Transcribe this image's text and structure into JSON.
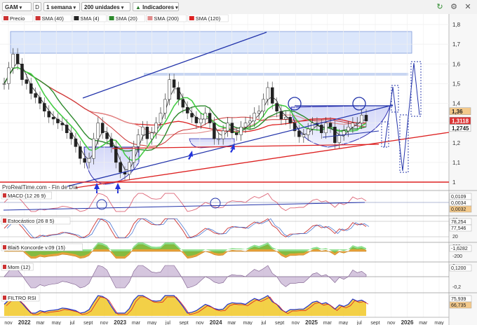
{
  "toolbar": {
    "symbol": "GAM",
    "d_button": "D",
    "period": "1 semana",
    "units": "200 unidades",
    "indicators": "Indicadores",
    "close_icon": "x-icon",
    "settings_icon": "gear-icon",
    "refresh_icon": "refresh-icon"
  },
  "main_legend": [
    {
      "label": "Precio",
      "color": "#cc3333"
    },
    {
      "label": "SMA (40)",
      "color": "#cc3333"
    },
    {
      "label": "SMA (4)",
      "color": "#222222"
    },
    {
      "label": "SMA (20)",
      "color": "#2d8a2d"
    },
    {
      "label": "SMA (200)",
      "color": "#e08a8a"
    },
    {
      "label": "SMA (120)",
      "color": "#dd2222"
    }
  ],
  "watermark": "ProRealTime.com - Fin de Día",
  "chart_data": {
    "type": "candlestick",
    "instrument": "GAM",
    "x_ticks": [
      "nov",
      "2022",
      "mar",
      "may",
      "jul",
      "sept",
      "nov",
      "2023",
      "mar",
      "may",
      "jul",
      "sept",
      "nov",
      "2024",
      "mar",
      "may",
      "jul",
      "sept",
      "nov",
      "2025",
      "mar",
      "may",
      "jul",
      "sept",
      "nov",
      "2026",
      "mar",
      "may"
    ],
    "y_ticks": [
      "1,8",
      "1,7",
      "1,6",
      "1,5",
      "1,4",
      "1,3",
      "1,2",
      "1,1",
      "1"
    ],
    "ylim": [
      1,
      1.8
    ],
    "price_tags": [
      {
        "text": "1,36",
        "value": 1.36,
        "bg": "#f3c98b"
      },
      {
        "text": "1,3118",
        "value": 1.3118,
        "bg": "#dd3333"
      },
      {
        "text": "1,2745",
        "value": 1.2745,
        "bg": "#ffffff"
      }
    ],
    "weekly_close": [
      1.5,
      1.58,
      1.65,
      1.6,
      1.52,
      1.5,
      1.45,
      1.43,
      1.4,
      1.36,
      1.33,
      1.32,
      1.3,
      1.29,
      1.25,
      1.22,
      1.18,
      1.12,
      1.1,
      1.12,
      1.22,
      1.3,
      1.25,
      1.22,
      1.18,
      1.1,
      1.05,
      1.04,
      1.1,
      1.18,
      1.24,
      1.28,
      1.22,
      1.25,
      1.3,
      1.35,
      1.42,
      1.52,
      1.48,
      1.42,
      1.38,
      1.35,
      1.33,
      1.3,
      1.32,
      1.35,
      1.3,
      1.22,
      1.22,
      1.26,
      1.3,
      1.25,
      1.24,
      1.28,
      1.3,
      1.31,
      1.35,
      1.36,
      1.42,
      1.48,
      1.4,
      1.36,
      1.32,
      1.33,
      1.3,
      1.26,
      1.23,
      1.24,
      1.27,
      1.3,
      1.29,
      1.25,
      1.3,
      1.28,
      1.2,
      1.24,
      1.26,
      1.28,
      1.3,
      1.3,
      1.34,
      1.31
    ],
    "annotations": {
      "upper_channel_line": [
        [
          0.29,
          1.44
        ],
        [
          0.92,
          1.77
        ]
      ],
      "lower_channel_line": [
        [
          0.15,
          1.0
        ],
        [
          0.88,
          1.28
        ]
      ]
    },
    "indicators": [
      {
        "name": "MACD (12 26 9)",
        "y_ticks": [
          "0,01"
        ],
        "value_tags": [
          {
            "text": "0,0109",
            "bg": "#ffffff"
          },
          {
            "text": "0,0034",
            "bg": "#ffffff"
          },
          {
            "text": "0,0032",
            "bg": "#f3c98b"
          }
        ]
      },
      {
        "name": "Estocástico (26 8 5)",
        "y_ticks": [
          "80",
          "20"
        ],
        "value_tags": [
          {
            "text": "78,254",
            "bg": "#ffffff"
          },
          {
            "text": "77,546",
            "bg": "#ffffff"
          }
        ]
      },
      {
        "name": "Blai5 Koncorde v.09 (15)",
        "y_ticks": [
          "200",
          "-200"
        ],
        "value_tags": [
          {
            "text": "-1,6282",
            "bg": "#ffffff"
          }
        ]
      },
      {
        "name": "Mom (12)",
        "y_ticks": [
          "0",
          "-0,2"
        ],
        "value_tags": [
          {
            "text": "0,1200",
            "bg": "#ffffff"
          }
        ]
      },
      {
        "name": "FILTRO RSI",
        "y_ticks": [],
        "value_tags": [
          {
            "text": "75,939",
            "bg": "#ffffff"
          },
          {
            "text": "66,735",
            "bg": "#f3c98b"
          }
        ]
      }
    ]
  }
}
